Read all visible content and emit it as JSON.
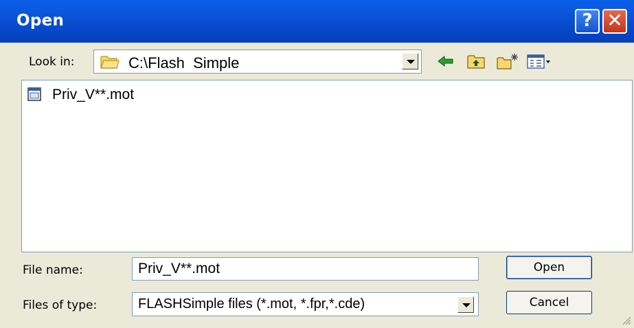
{
  "window": {
    "title": "Open",
    "help_glyph": "?",
    "close_glyph": "✕"
  },
  "lookin": {
    "label": "Look in:",
    "value": "C:\\Flash  Simple"
  },
  "toolbar_icons": [
    "back-arrow-icon",
    "up-one-level-icon",
    "create-new-folder-icon",
    "view-menu-icon"
  ],
  "files": [
    {
      "name": "Priv_V**.mot",
      "icon": "file-icon"
    }
  ],
  "filename": {
    "label": "File name:",
    "value": "Priv_V**.mot"
  },
  "filetype": {
    "label": "Files of type:",
    "value": "FLASHSimple  files (*.mot,  *.fpr,*.cde)"
  },
  "buttons": {
    "open_label": "Open",
    "cancel_label": "Cancel"
  },
  "colors": {
    "titlebar": "#0a5fe8",
    "client": "#ebe9d8",
    "border": "#7f9db9"
  }
}
